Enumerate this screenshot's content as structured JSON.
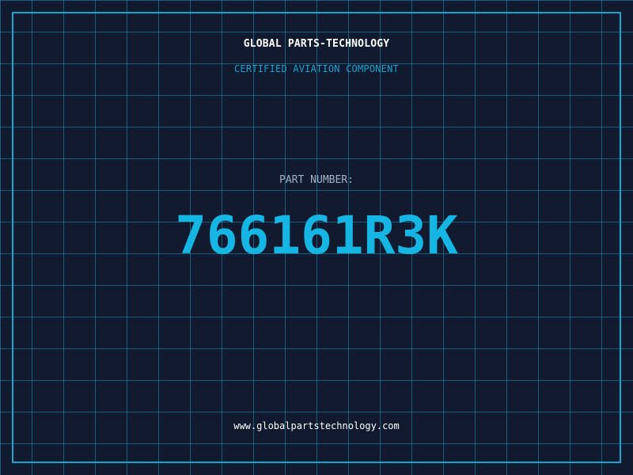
{
  "brand": {
    "name": "GLOBAL PARTS-TECHNOLOGY",
    "tagline": "CERTIFIED AVIATION COMPONENT"
  },
  "part": {
    "label": "PART NUMBER:",
    "number": "766161R3K"
  },
  "footer": {
    "website": "www.globalpartstechnology.com"
  },
  "colors": {
    "background": "#111a2e",
    "grid": "#2094b6",
    "accent": "#1aa7cf",
    "part_number": "#15b6e3"
  }
}
